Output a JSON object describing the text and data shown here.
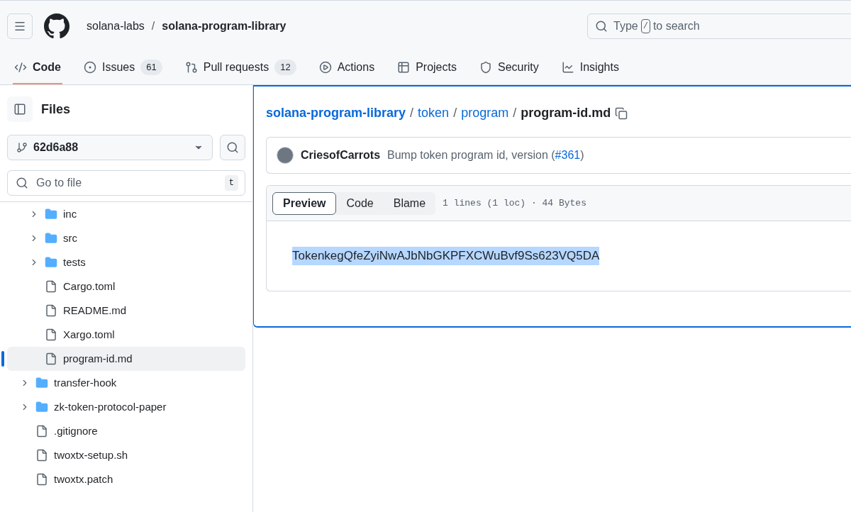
{
  "header": {
    "owner": "solana-labs",
    "separator": "/",
    "repo": "solana-program-library",
    "search": {
      "before": "Type",
      "key": "/",
      "after": "to search"
    }
  },
  "tabs": [
    {
      "label": "Code",
      "selected": true
    },
    {
      "label": "Issues",
      "count": "61",
      "selected": false
    },
    {
      "label": "Pull requests",
      "count": "12",
      "selected": false
    },
    {
      "label": "Actions",
      "selected": false
    },
    {
      "label": "Projects",
      "selected": false
    },
    {
      "label": "Security",
      "selected": false
    },
    {
      "label": "Insights",
      "selected": false
    }
  ],
  "sidebar": {
    "title": "Files",
    "branch": "62d6a88",
    "goto": {
      "placeholder": "Go to file",
      "key": "t"
    },
    "tree": [
      {
        "children": [
          {
            "label": "inc",
            "kind": "folder",
            "selected": false
          },
          {
            "label": "src",
            "kind": "folder",
            "selected": false
          },
          {
            "label": "tests",
            "kind": "folder",
            "selected": false
          },
          {
            "label": "Cargo.toml",
            "kind": "file",
            "selected": false
          },
          {
            "label": "README.md",
            "kind": "file",
            "selected": false
          },
          {
            "label": "Xargo.toml",
            "kind": "file",
            "selected": false
          },
          {
            "label": "program-id.md",
            "kind": "file",
            "selected": true
          }
        ]
      },
      {
        "label": "transfer-hook",
        "kind": "folder",
        "selected": false
      },
      {
        "label": "zk-token-protocol-paper",
        "kind": "folder",
        "selected": false
      },
      {
        "label": ".gitignore",
        "kind": "file",
        "selected": false
      },
      {
        "label": "twoxtx-setup.sh",
        "kind": "file",
        "selected": false
      },
      {
        "label": "twoxtx.patch",
        "kind": "file",
        "selected": false
      }
    ]
  },
  "breadcrumb": {
    "links": [
      "solana-program-library",
      "token",
      "program"
    ],
    "separator": "/",
    "current": "program-id.md"
  },
  "commit": {
    "author": "CriesofCarrots",
    "message": "Bump token program id, version (",
    "pr": "#361",
    "close": ")"
  },
  "viewer": {
    "modes": [
      {
        "label": "Preview",
        "selected": true
      },
      {
        "label": "Code",
        "selected": false
      },
      {
        "label": "Blame",
        "selected": false
      }
    ],
    "info": "1 lines (1 loc) · 44 Bytes",
    "content": "TokenkegQfeZyiNwAJbNbGKPFXCWuBvf9Ss623VQ5DA"
  }
}
